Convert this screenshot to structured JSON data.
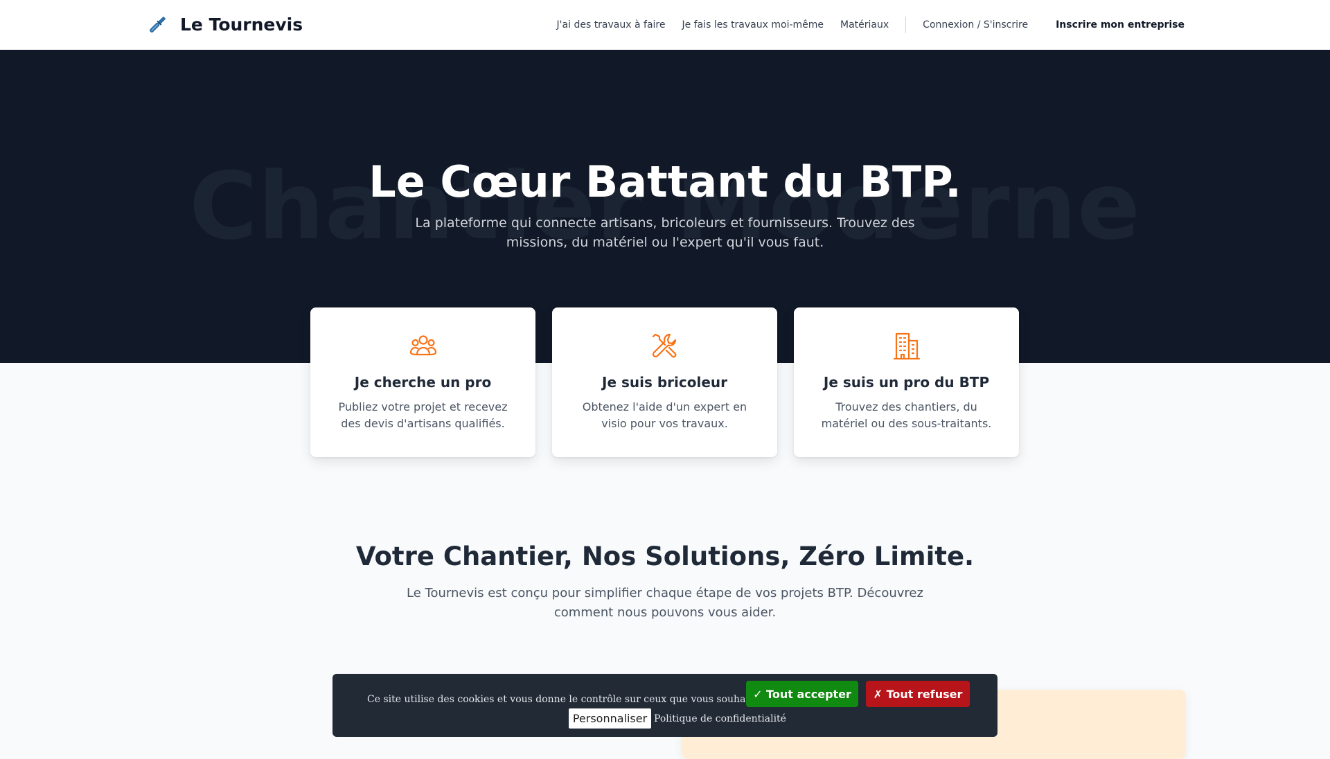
{
  "header": {
    "brand": "Le Tournevis",
    "nav": [
      "J'ai des travaux à faire",
      "Je fais les travaux moi-même",
      "Matériaux"
    ],
    "login": "Connexion / S'inscrire",
    "cta": "Inscrire mon entreprise"
  },
  "hero": {
    "watermark": "Chantier Moderne",
    "title": "Le Cœur Battant du BTP.",
    "subtitle": "La plateforme qui connecte artisans, bricoleurs et fournisseurs. Trouvez des missions, du matériel ou l'expert qu'il vous faut."
  },
  "cards": [
    {
      "title": "Je cherche un pro",
      "text": "Publiez votre projet et recevez des devis d'artisans qualifiés.",
      "icon": "users-icon"
    },
    {
      "title": "Je suis bricoleur",
      "text": "Obtenez l'aide d'un expert en visio pour vos travaux.",
      "icon": "tools-icon"
    },
    {
      "title": "Je suis un pro du BTP",
      "text": "Trouvez des chantiers, du matériel ou des sous-traitants.",
      "icon": "building-icon"
    }
  ],
  "section": {
    "title": "Votre Chantier, Nos Solutions, Zéro Limite.",
    "subtitle": "Le Tournevis est conçu pour simplifier chaque étape de vos projets BTP. Découvrez comment nous pouvons vous aider."
  },
  "cookie": {
    "text": "Ce site utilise des cookies et vous donne le contrôle sur ceux que vous souhaitez activer",
    "accept": "✓ Tout accepter",
    "refuse": "✗ Tout refuser",
    "customize": "Personnaliser",
    "policy": "Politique de confidentialité"
  },
  "colors": {
    "accent": "#f97316",
    "brand_icon": "#2f6fa8",
    "hero_bg": "#111827",
    "accept": "#108a10",
    "refuse": "#b8151a"
  }
}
